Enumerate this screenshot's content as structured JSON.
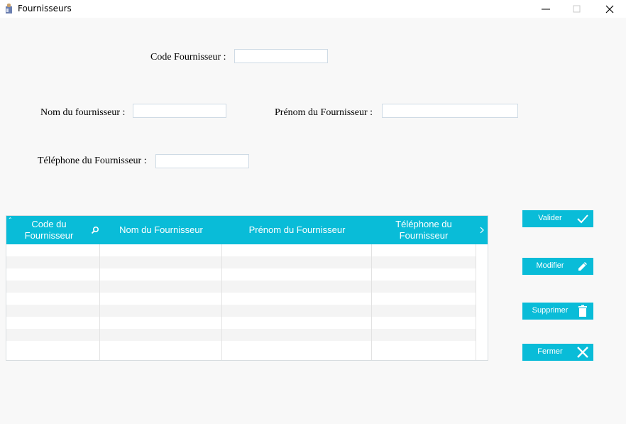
{
  "window": {
    "title": "Fournisseurs",
    "controls": [
      "minimize-icon",
      "maximize-icon",
      "close-icon"
    ]
  },
  "form": {
    "code_label": "Code Fournisseur :",
    "code_value": "",
    "nom_label": "Nom du fournisseur :",
    "nom_value": "",
    "prenom_label": "Prénom du Fournisseur :",
    "prenom_value": "",
    "telephone_label": "Téléphone du Fournisseur :",
    "telephone_value": ""
  },
  "table": {
    "columns": [
      {
        "line1": "Code du",
        "line2": "Fournisseur"
      },
      {
        "line1": "Nom du Fournisseur",
        "line2": ""
      },
      {
        "line1": "Prénom du Fournisseur",
        "line2": ""
      },
      {
        "line1": "Téléphone du",
        "line2": "Fournisseur"
      }
    ],
    "rows": []
  },
  "actions": {
    "valider": "Valider",
    "modifier": "Modifier",
    "supprimer": "Supprimer",
    "fermer": "Fermer"
  },
  "colors": {
    "accent": "#09bcd8",
    "background": "#f8f8f8"
  },
  "icons": [
    "search-icon",
    "chevron-right-icon",
    "check-icon",
    "pencil-icon",
    "trash-icon",
    "x-icon"
  ]
}
